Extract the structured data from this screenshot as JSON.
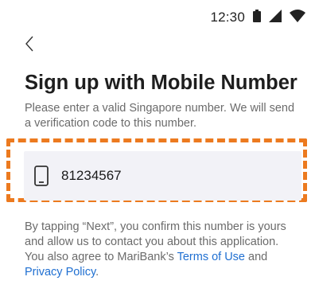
{
  "status_bar": {
    "time": "12:30",
    "icons": [
      "battery-icon",
      "cell-signal-icon",
      "wifi-icon"
    ]
  },
  "header": {
    "back_icon": "chevron-left-icon",
    "title": "Sign up with Mobile Number",
    "subtitle": "Please enter a valid Singapore number. We will send a verification code to this number."
  },
  "phone_field": {
    "icon": "mobile-phone-icon",
    "value": "81234567"
  },
  "disclaimer": {
    "text_before": "By tapping “Next”, you confirm this number is yours and allow us to contact you about this application. You also agree to MariBank’s ",
    "terms_link": "Terms of Use",
    "text_between": " and ",
    "privacy_link": "Privacy Policy",
    "text_after": "."
  },
  "colors": {
    "highlight": "#ec7a1f",
    "link": "#1f6fd1",
    "field_background": "#f2f2f7",
    "secondary_text": "#6b6b6b"
  }
}
